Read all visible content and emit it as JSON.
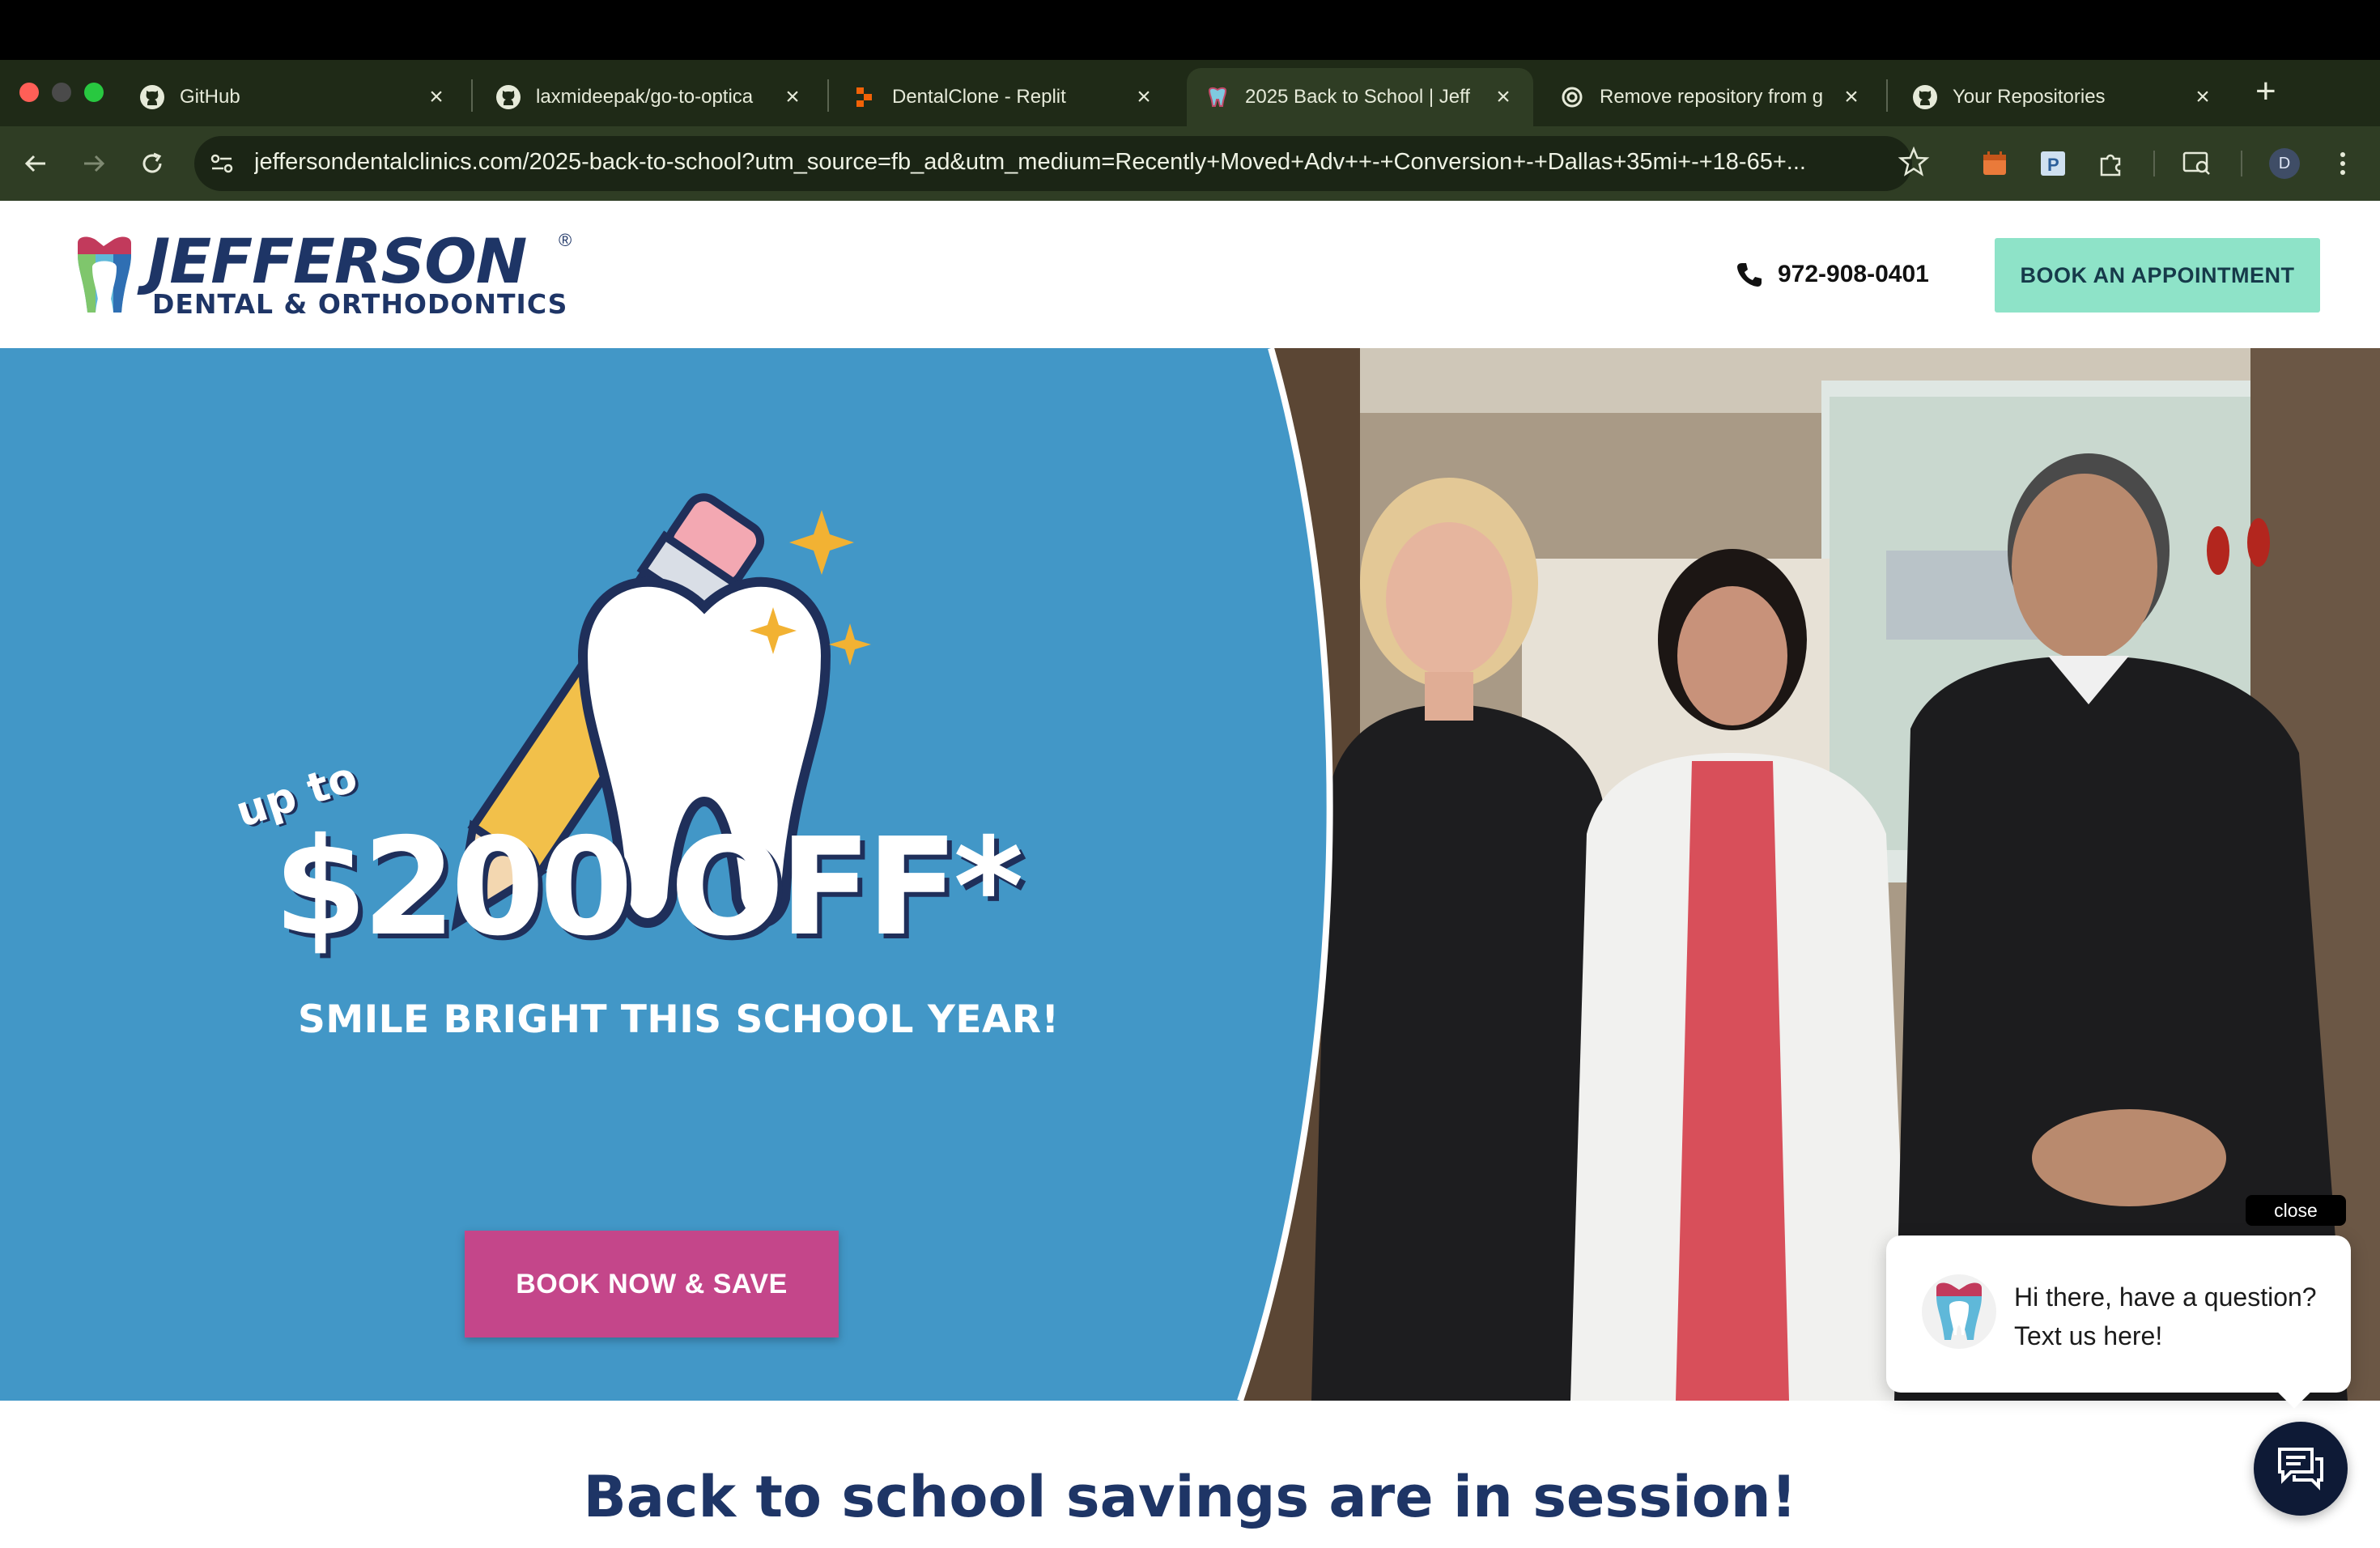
{
  "browser": {
    "tabs": [
      {
        "title": "GitHub",
        "favicon": "github-icon",
        "active": false
      },
      {
        "title": "laxmideepak/go-to-optica",
        "favicon": "github-icon",
        "active": false
      },
      {
        "title": "DentalClone - Replit",
        "favicon": "replit-icon",
        "active": false
      },
      {
        "title": "2025 Back to School | Jeff",
        "favicon": "tooth-icon",
        "active": true
      },
      {
        "title": "Remove repository from g",
        "favicon": "openai-icon",
        "active": false
      },
      {
        "title": "Your Repositories",
        "favicon": "github-icon",
        "active": false
      }
    ],
    "url": "jeffersondentalclinics.com/2025-back-to-school?utm_source=fb_ad&utm_medium=Recently+Moved+Adv++-+Conversion+-+Dallas+35mi+-+18-65+...",
    "profile_initial": "D",
    "toolbar_bg": "#2f3d24",
    "tabstrip_bg": "#1f2a17"
  },
  "site": {
    "logo": {
      "word": "JEFFERSON",
      "reg": "®",
      "sub": "DENTAL & ORTHODONTICS"
    },
    "phone": "972-908-0401",
    "book_button": "BOOK AN APPOINTMENT",
    "colors": {
      "brand_navy": "#1e3566",
      "mint": "#8ee3c8",
      "hero_blue": "#4297c7",
      "cta_pink": "#c4468a"
    }
  },
  "hero": {
    "up_to": "up to",
    "price": "$200 OFF*",
    "tagline": "SMILE BRIGHT THIS SCHOOL YEAR!",
    "cta": "BOOK NOW & SAVE"
  },
  "chat": {
    "close_label": "close",
    "message": "Hi there, have a question? Text us here!"
  },
  "section": {
    "heading": "Back to school savings are in session!"
  }
}
